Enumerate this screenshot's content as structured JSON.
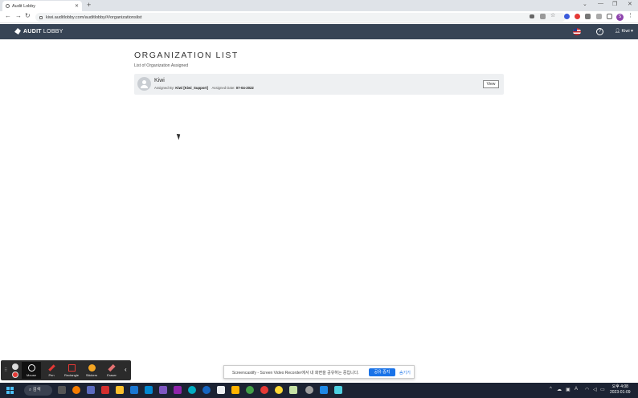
{
  "browser": {
    "tab_title": "Audit Lobby",
    "tab_close": "✕",
    "new_tab": "+",
    "url": "kiwi.auditlobby.com/auditlobby/#/organizationslist",
    "profile_initial": "S"
  },
  "app": {
    "logo_bold": "AUDIT",
    "logo_light": "LOBBY",
    "help": "?",
    "user_label": "Kiwi"
  },
  "page": {
    "title": "ORGANIZATION LIST",
    "subtitle": "List of Organization Assigned"
  },
  "organizations": [
    {
      "name": "Kiwi",
      "assigned_by_label": "Assigned By:",
      "assigned_by": "Kiwi [Kiwi_Support]",
      "assigned_date_label": "Assigned Date:",
      "assigned_date": "07-04-2022",
      "view_label": "View"
    }
  ],
  "screencastify": {
    "tools": [
      "Mouse",
      "Pen",
      "Rectangle",
      "Stickers",
      "Eraser"
    ]
  },
  "share_bar": {
    "message": "Screencastify - Screen Video Recorder에서 내 화면을 공유하는 중입니다.",
    "stop_label": "공유 중지",
    "hide_label": "숨기기"
  },
  "taskbar": {
    "search_label": "검색",
    "time": "오후 4:08",
    "date": "2023-01-09"
  },
  "colors": {
    "appbar": "#374455",
    "card": "#eef0f2",
    "accent": "#1a73e8"
  }
}
